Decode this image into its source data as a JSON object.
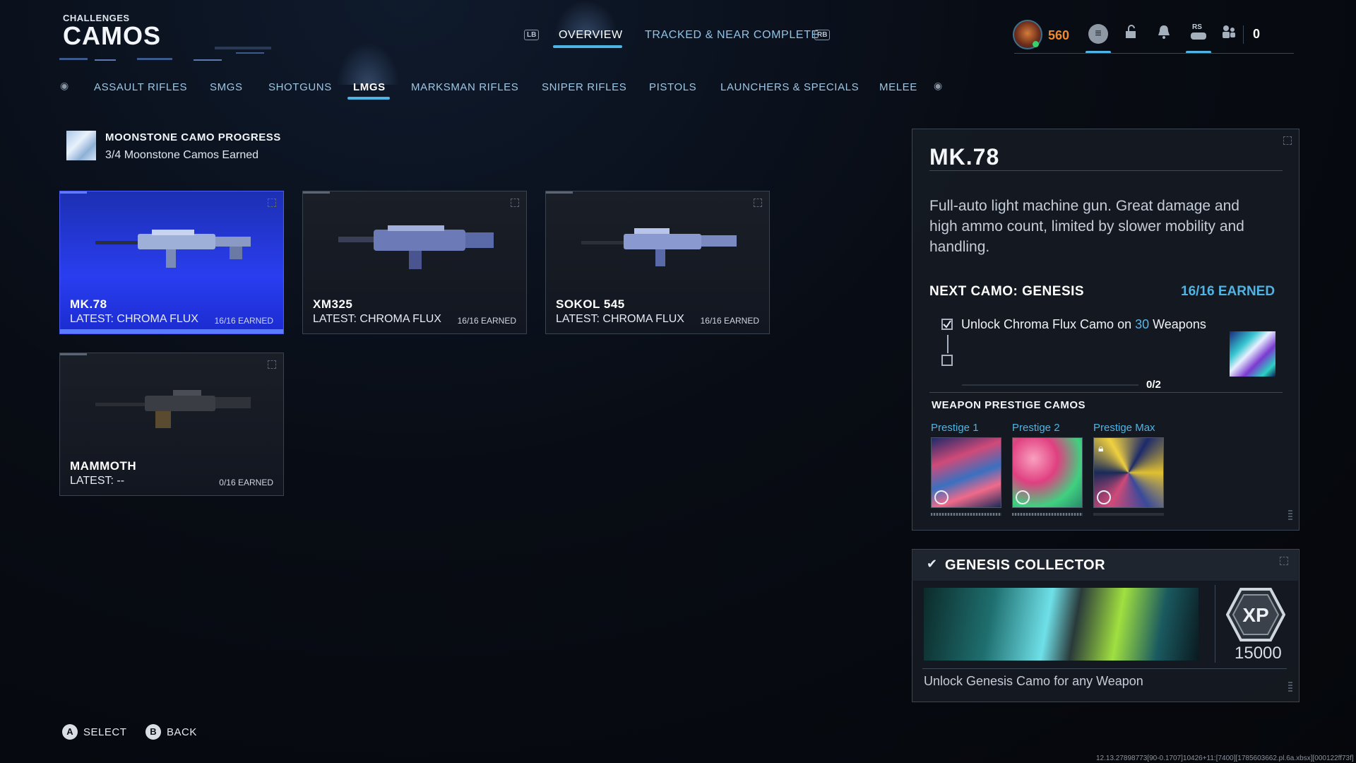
{
  "header": {
    "section": "CHALLENGES",
    "title": "CAMOS",
    "lb": "LB",
    "rb": "RB",
    "tabs": [
      {
        "label": "OVERVIEW",
        "active": true
      },
      {
        "label": "TRACKED & NEAR COMPLETE",
        "active": false
      }
    ]
  },
  "status": {
    "rank_value": "560",
    "rs_label": "RS",
    "currency": "0",
    "icons": [
      "menu-icon",
      "unlock-icon",
      "notification-bell-icon",
      "controller-icon",
      "party-icon"
    ]
  },
  "categories": {
    "tabs": [
      "ASSAULT RIFLES",
      "SMGS",
      "SHOTGUNS",
      "LMGS",
      "MARKSMAN RIFLES",
      "SNIPER RIFLES",
      "PISTOLS",
      "LAUNCHERS & SPECIALS",
      "MELEE"
    ],
    "active": "LMGS"
  },
  "moonstone": {
    "title": "MOONSTONE CAMO PROGRESS",
    "subtitle": "3/4 Moonstone Camos Earned"
  },
  "weapons": [
    {
      "name": "MK.78",
      "latest": "LATEST: CHROMA FLUX",
      "earned": "16/16 EARNED",
      "selected": true
    },
    {
      "name": "XM325",
      "latest": "LATEST: CHROMA FLUX",
      "earned": "16/16 EARNED",
      "selected": false
    },
    {
      "name": "SOKOL 545",
      "latest": "LATEST: CHROMA FLUX",
      "earned": "16/16 EARNED",
      "selected": false
    },
    {
      "name": "MAMMOTH",
      "latest": "LATEST: --",
      "earned": "0/16 EARNED",
      "selected": false
    }
  ],
  "detail": {
    "title": "MK.78",
    "description": "Full-auto light machine gun. Great damage and high ammo count, limited by slower mobility and handling.",
    "next_camo": "NEXT CAMO: GENESIS",
    "next_earned": "16/16 EARNED",
    "task_pre": "Unlock Chroma Flux Camo on ",
    "task_num": "30",
    "task_post": " Weapons",
    "progress": "0/2",
    "progress_fraction": 0,
    "prestige_heading": "WEAPON PRESTIGE CAMOS",
    "prestige": [
      {
        "label": "Prestige 1",
        "locked": false
      },
      {
        "label": "Prestige 2",
        "locked": false
      },
      {
        "label": "Prestige Max",
        "locked": true
      }
    ]
  },
  "collector": {
    "title": "GENESIS COLLECTOR",
    "xp_label": "XP",
    "xp": "15000",
    "description": "Unlock Genesis Camo for any Weapon"
  },
  "footer": {
    "select_key": "A",
    "select_label": "SELECT",
    "back_key": "B",
    "back_label": "BACK",
    "debug": "12.13.27898773[90-0.1707]10426+11:[7400][1785603662.pl.6a.xbsx][000122ff73f]"
  },
  "colors": {
    "accent": "#4fb4e4",
    "selected_card": "#2a3ef0",
    "rank": "#f08a2a"
  }
}
